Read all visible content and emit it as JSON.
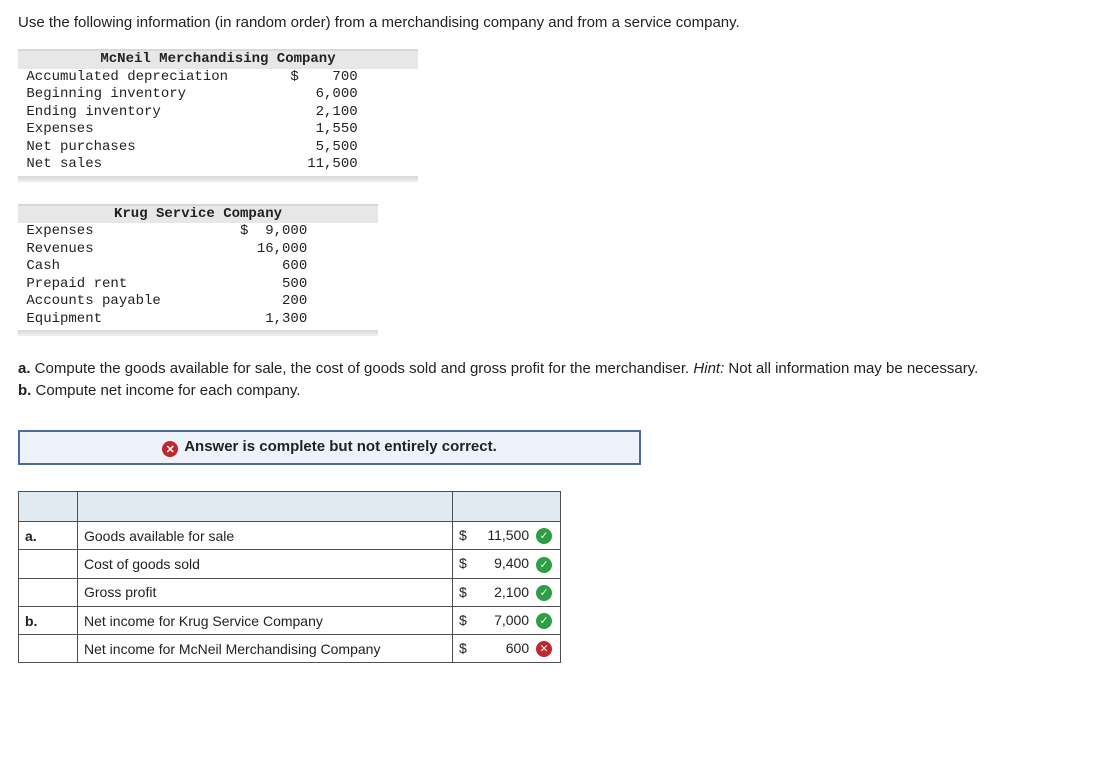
{
  "intro": "Use the following information (in random order) from a merchandising company and from a service company.",
  "table1": {
    "title": "McNeil Merchandising Company",
    "rows": [
      {
        "label": "Accumulated depreciation",
        "currency": "$",
        "value": "700"
      },
      {
        "label": "Beginning inventory",
        "currency": "",
        "value": "6,000"
      },
      {
        "label": "Ending inventory",
        "currency": "",
        "value": "2,100"
      },
      {
        "label": "Expenses",
        "currency": "",
        "value": "1,550"
      },
      {
        "label": "Net purchases",
        "currency": "",
        "value": "5,500"
      },
      {
        "label": "Net sales",
        "currency": "",
        "value": "11,500"
      }
    ]
  },
  "table2": {
    "title": "Krug Service Company",
    "rows": [
      {
        "label": "Expenses",
        "currency": "$",
        "value": "9,000"
      },
      {
        "label": "Revenues",
        "currency": "",
        "value": "16,000"
      },
      {
        "label": "Cash",
        "currency": "",
        "value": "600"
      },
      {
        "label": "Prepaid rent",
        "currency": "",
        "value": "500"
      },
      {
        "label": "Accounts payable",
        "currency": "",
        "value": "200"
      },
      {
        "label": "Equipment",
        "currency": "",
        "value": "1,300"
      }
    ]
  },
  "questions": {
    "a_letter": "a.",
    "a_text": " Compute the goods available for sale, the cost of goods sold and gross profit for the merchandiser. ",
    "hint_label": "Hint:",
    "hint_text": " Not all information may be necessary.",
    "b_letter": "b.",
    "b_text": " Compute net income for each company."
  },
  "feedback": {
    "icon_name": "x-icon",
    "text": "Answer is complete but not entirely correct."
  },
  "answer": {
    "rows": [
      {
        "letter": "a.",
        "desc": "Goods available for sale",
        "currency": "$",
        "value": "11,500",
        "status": "ok"
      },
      {
        "letter": "",
        "desc": "Cost of goods sold",
        "currency": "$",
        "value": "9,400",
        "status": "ok"
      },
      {
        "letter": "",
        "desc": "Gross profit",
        "currency": "$",
        "value": "2,100",
        "status": "ok"
      },
      {
        "letter": "b.",
        "desc": "Net income for Krug Service Company",
        "currency": "$",
        "value": "7,000",
        "status": "ok"
      },
      {
        "letter": "",
        "desc": "Net income for McNeil Merchandising Company",
        "currency": "$",
        "value": "600",
        "status": "bad"
      }
    ]
  },
  "icons": {
    "check": "✓",
    "cross": "✕"
  }
}
